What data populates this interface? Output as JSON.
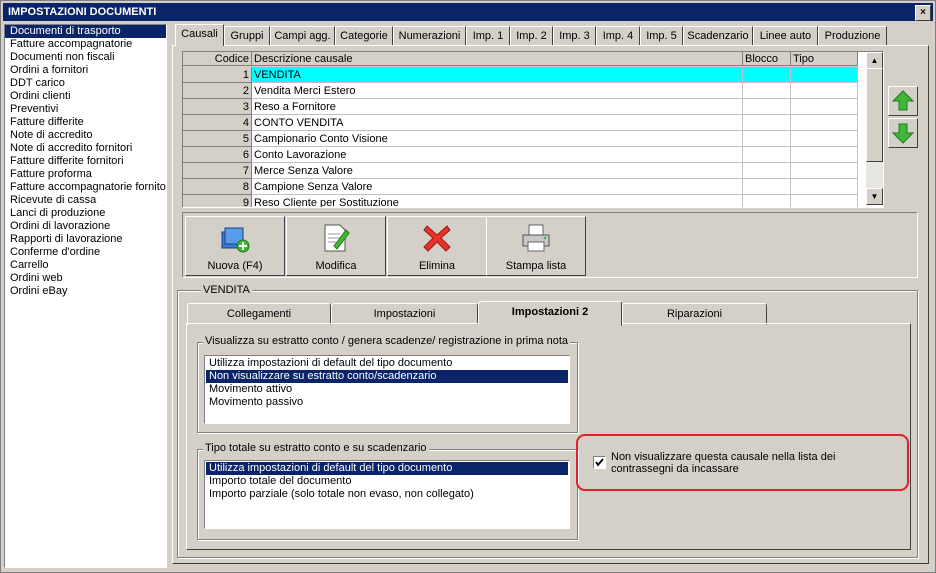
{
  "window": {
    "title": "IMPOSTAZIONI DOCUMENTI",
    "close_label": "×"
  },
  "document_types": [
    "Documenti di trasporto",
    "Fatture accompagnatorie",
    "Documenti non fiscali",
    "Ordini a fornitori",
    "DDT carico",
    "Ordini clienti",
    "Preventivi",
    "Fatture differite",
    "Note di accredito",
    "Note di accredito fornitori",
    "Fatture differite fornitori",
    "Fatture proforma",
    "Fatture accompagnatorie fornitori",
    "Ricevute di cassa",
    "Lanci di produzione",
    "Ordini di lavorazione",
    "Rapporti di lavorazione",
    "Conferme d'ordine",
    "Carrello",
    "Ordini web",
    "Ordini eBay"
  ],
  "selected_document_type": "Documenti di trasporto",
  "tabs": [
    "Causali",
    "Gruppi",
    "Campi agg.",
    "Categorie",
    "Numerazioni",
    "Imp. 1",
    "Imp. 2",
    "Imp. 3",
    "Imp. 4",
    "Imp. 5",
    "Scadenzario",
    "Linee auto",
    "Produzione"
  ],
  "active_tab": "Causali",
  "grid": {
    "headers": {
      "code": "Codice",
      "description": "Descrizione causale",
      "block": "Blocco",
      "type": "Tipo"
    },
    "rows": [
      {
        "code": "1",
        "description": "VENDITA"
      },
      {
        "code": "2",
        "description": "Vendita Merci Estero"
      },
      {
        "code": "3",
        "description": "Reso a Fornitore"
      },
      {
        "code": "4",
        "description": "CONTO VENDITA"
      },
      {
        "code": "5",
        "description": "Campionario Conto Visione"
      },
      {
        "code": "6",
        "description": "Conto Lavorazione"
      },
      {
        "code": "7",
        "description": "Merce Senza Valore"
      },
      {
        "code": "8",
        "description": "Campione Senza Valore"
      },
      {
        "code": "9",
        "description": "Reso Cliente per Sostituzione"
      }
    ],
    "selected_code": "1"
  },
  "colors": {
    "selection": "#0a246a",
    "grid_highlight": "#00ffff",
    "annotation": "#e0202a",
    "arrow_green": "#3fb83a"
  },
  "toolbar": {
    "new_label": "Nuova (F4)",
    "edit_label": "Modifica",
    "delete_label": "Elimina",
    "print_label": "Stampa lista"
  },
  "detail": {
    "group_title": "VENDITA",
    "subtabs": [
      "Collegamenti",
      "Impostazioni",
      "Impostazioni 2",
      "Riparazioni"
    ],
    "active_subtab": "Impostazioni 2",
    "statement_group": {
      "title": "Visualizza su estratto conto / genera scadenze/ registrazione  in prima nota",
      "options": [
        "Utilizza impostazioni di default del tipo documento",
        "Non visualizzare su estratto conto/scadenzario",
        "Movimento attivo",
        "Movimento passivo"
      ],
      "selected": "Non visualizzare su estratto conto/scadenzario"
    },
    "total_group": {
      "title": "Tipo totale su estratto conto e su scadenzario",
      "options": [
        "Utilizza impostazioni di default del tipo documento",
        "Importo totale del documento",
        "Importo parziale (solo totale non evaso, non collegato)"
      ],
      "selected": "Utilizza impostazioni di default del tipo documento"
    },
    "cod_checkbox": {
      "label": "Non visualizzare questa causale nella lista dei contrassegni da incassare",
      "checked": true
    }
  }
}
